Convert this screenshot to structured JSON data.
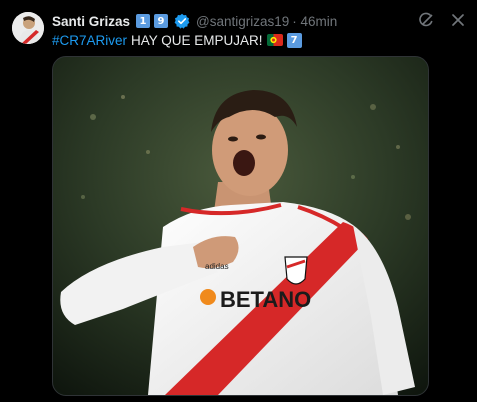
{
  "tweet": {
    "author": {
      "display_name": "Santi Grizas",
      "badges": [
        "1",
        "9"
      ],
      "verified": true,
      "handle": "@santigrizas19",
      "time": "· 46min"
    },
    "text": {
      "hashtag": "#CR7ARiver",
      "message": "HAY QUE EMPUJAR!",
      "flag": "portugal-flag",
      "badge": "7"
    },
    "media": {
      "shirt_sponsor": "BETANO",
      "shirt_brand": "adidas"
    },
    "actions": [
      "grok-icon",
      "close-icon"
    ]
  },
  "colors": {
    "background": "#000000",
    "text": "#e7e9ea",
    "muted": "#71767b",
    "link": "#1d9bf0",
    "verified": "#1d9bf0",
    "keycap": "#5b9be0",
    "sash": "#d62828"
  }
}
